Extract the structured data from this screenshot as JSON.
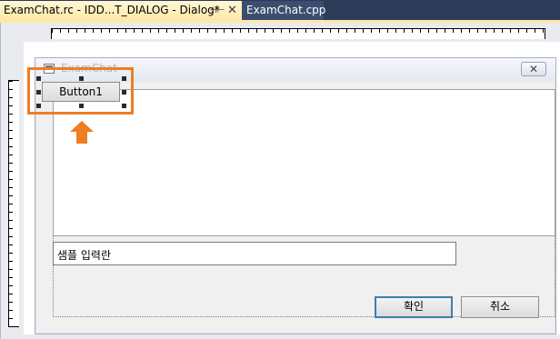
{
  "tabs": [
    {
      "label": "ExamChat.rc - IDD...T_DIALOG - Dialog*",
      "active": true,
      "pin_icon": "pin-icon",
      "close_icon": "close-icon"
    },
    {
      "label": "ExamChat.cpp",
      "active": false
    }
  ],
  "dialog": {
    "title": "ExamChat",
    "close_label": "✕",
    "selected_button_label": "Button1",
    "input_value": "샘플 입력란",
    "ok_label": "확인",
    "cancel_label": "취소"
  },
  "colors": {
    "tab_bar": "#2b3b58",
    "active_tab": "#ffe8a6",
    "highlight": "#ef7d22",
    "default_button_border": "#3c7fb1"
  }
}
